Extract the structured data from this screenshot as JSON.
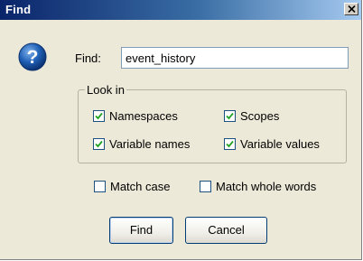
{
  "window": {
    "title": "Find",
    "close_glyph": "X"
  },
  "icon": {
    "name": "help-question-icon",
    "glyph": "?",
    "color": "#1f5fb4"
  },
  "find": {
    "label": "Find:",
    "value": "event_history"
  },
  "look_in": {
    "label": "Look in",
    "options": [
      {
        "label": "Namespaces",
        "checked": true
      },
      {
        "label": "Scopes",
        "checked": true
      },
      {
        "label": "Variable names",
        "checked": true
      },
      {
        "label": "Variable values",
        "checked": true
      }
    ]
  },
  "match": {
    "case_label": "Match case",
    "case_checked": false,
    "whole_words_label": "Match whole words",
    "whole_words_checked": false
  },
  "buttons": {
    "find_label": "Find",
    "cancel_label": "Cancel"
  },
  "colors": {
    "title_bar_start": "#0a246a",
    "dialog_background": "#ece9d8",
    "checkbox_border": "#1c5180",
    "check_mark": "#21a121"
  }
}
